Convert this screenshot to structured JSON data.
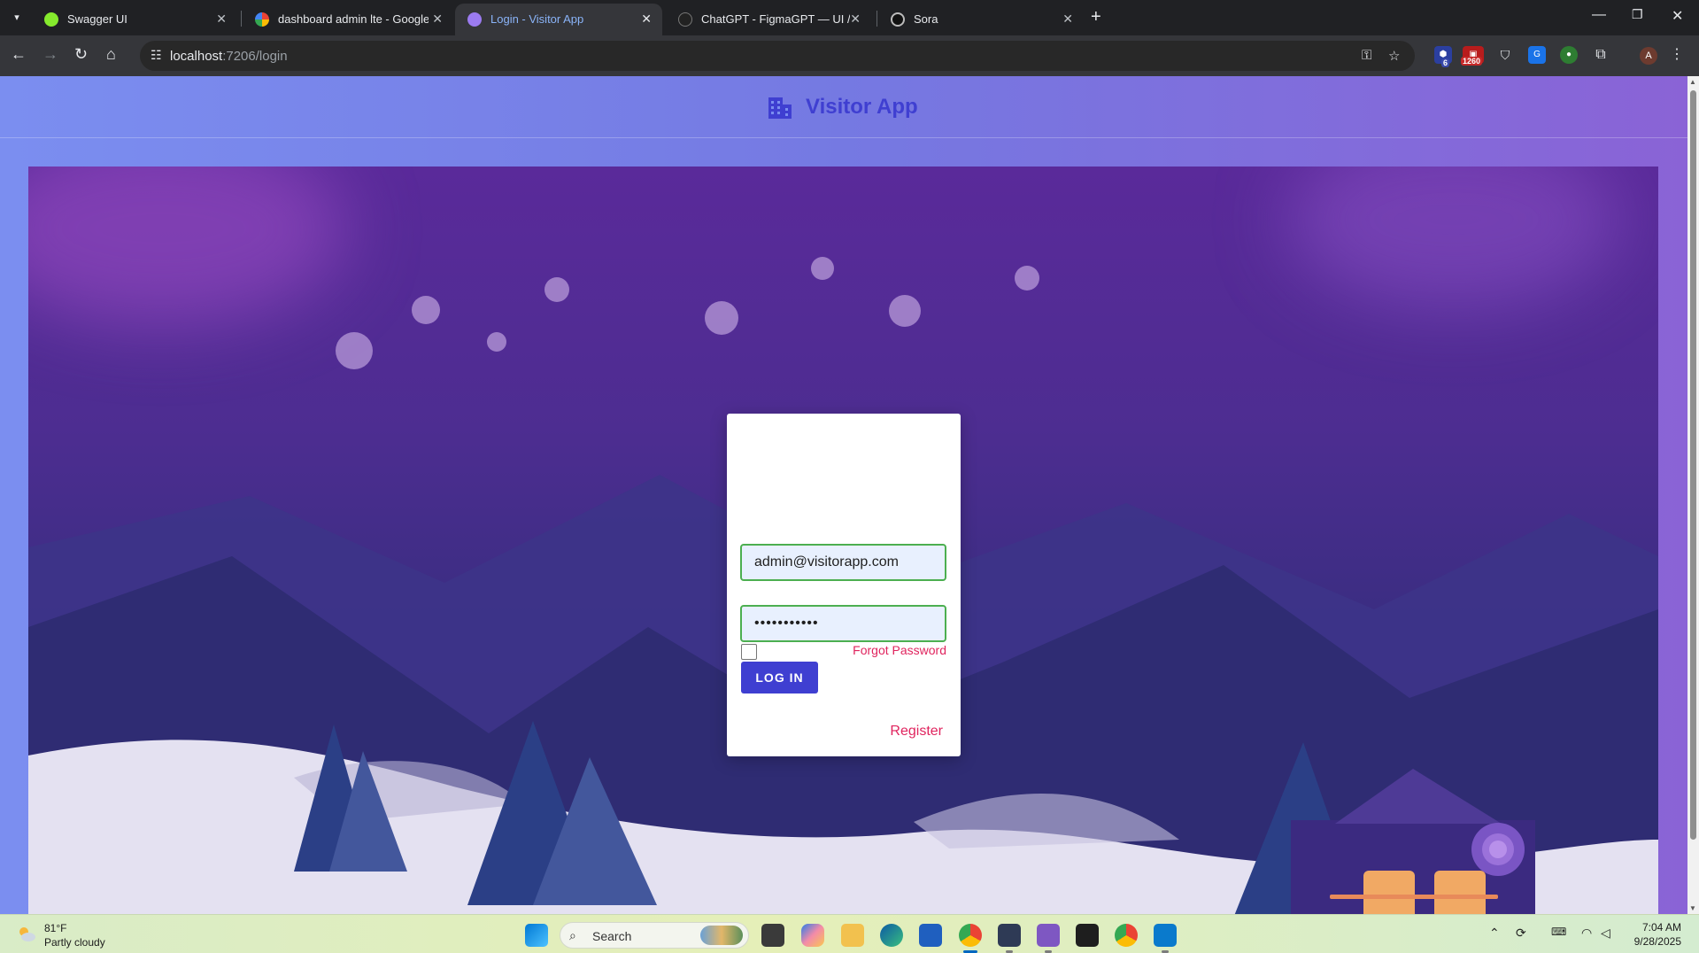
{
  "browser": {
    "tabs": [
      {
        "label": "Swagger UI",
        "active": false,
        "favicon": "swagger-favicon"
      },
      {
        "label": "dashboard admin lte - Google S",
        "active": false,
        "favicon": "google-favicon"
      },
      {
        "label": "Login - Visitor App",
        "active": true,
        "favicon": "app-favicon"
      },
      {
        "label": "ChatGPT - FigmaGPT — UI / UX",
        "active": false,
        "favicon": "chatgpt-favicon"
      },
      {
        "label": "Sora",
        "active": false,
        "favicon": "sora-favicon"
      }
    ],
    "url_host": "localhost",
    "url_path": ":7206/login",
    "extension_badges": {
      "first": "6",
      "second": "1260"
    },
    "profile_initial": "A"
  },
  "app": {
    "title": "Visitor App",
    "brand_icon": "building-icon"
  },
  "login": {
    "email_value": "admin@visitorapp.com",
    "password_value": "•••••••••••",
    "remember_checked": false,
    "forgot_label": "Forgot Password",
    "login_label": "LOG IN",
    "register_label": "Register",
    "accent_color": "#3f3fd1",
    "link_color": "#e0245e",
    "valid_border_color": "#4caf50"
  },
  "taskbar": {
    "weather_temp": "81°F",
    "weather_desc": "Partly cloudy",
    "search_label": "Search",
    "time": "7:04 AM",
    "date": "9/28/2025"
  }
}
